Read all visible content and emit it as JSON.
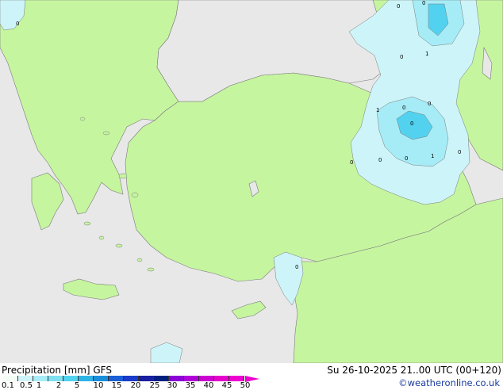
{
  "footer": {
    "legend_title": "Precipitation [mm]  GFS",
    "run_label": "Su 26-10-2025 21..00 UTC (00+120)",
    "credit": "©weatheronline.co.uk"
  },
  "legend": {
    "colors": [
      "#f5fdf6",
      "#cdf5f9",
      "#a6ecf7",
      "#7fe0f2",
      "#52d2ef",
      "#2db4e6",
      "#1a8edb",
      "#1a5fd6",
      "#1a3cc8",
      "#1a1fa0",
      "#002080",
      "#8a00d6",
      "#b000d8",
      "#cc00d0",
      "#e600cc",
      "#ee00d0"
    ],
    "ticks": [
      "0.1",
      "0.5",
      "1",
      "2",
      "5",
      "10",
      "15",
      "20",
      "25",
      "30",
      "35",
      "40",
      "45",
      "50"
    ]
  },
  "map": {
    "land_color": "#c6f5a0",
    "sea_color": "#e8e8e8",
    "light_precip_color": "#cdf5f9",
    "mid_precip_color": "#a6ecf7",
    "heavy_precip_color": "#52d2ef",
    "point_labels": [
      "0",
      "0",
      "0",
      "1",
      "0",
      "1",
      "0",
      "0",
      "0",
      "0",
      "0",
      "1",
      "0",
      "0",
      "0"
    ]
  }
}
